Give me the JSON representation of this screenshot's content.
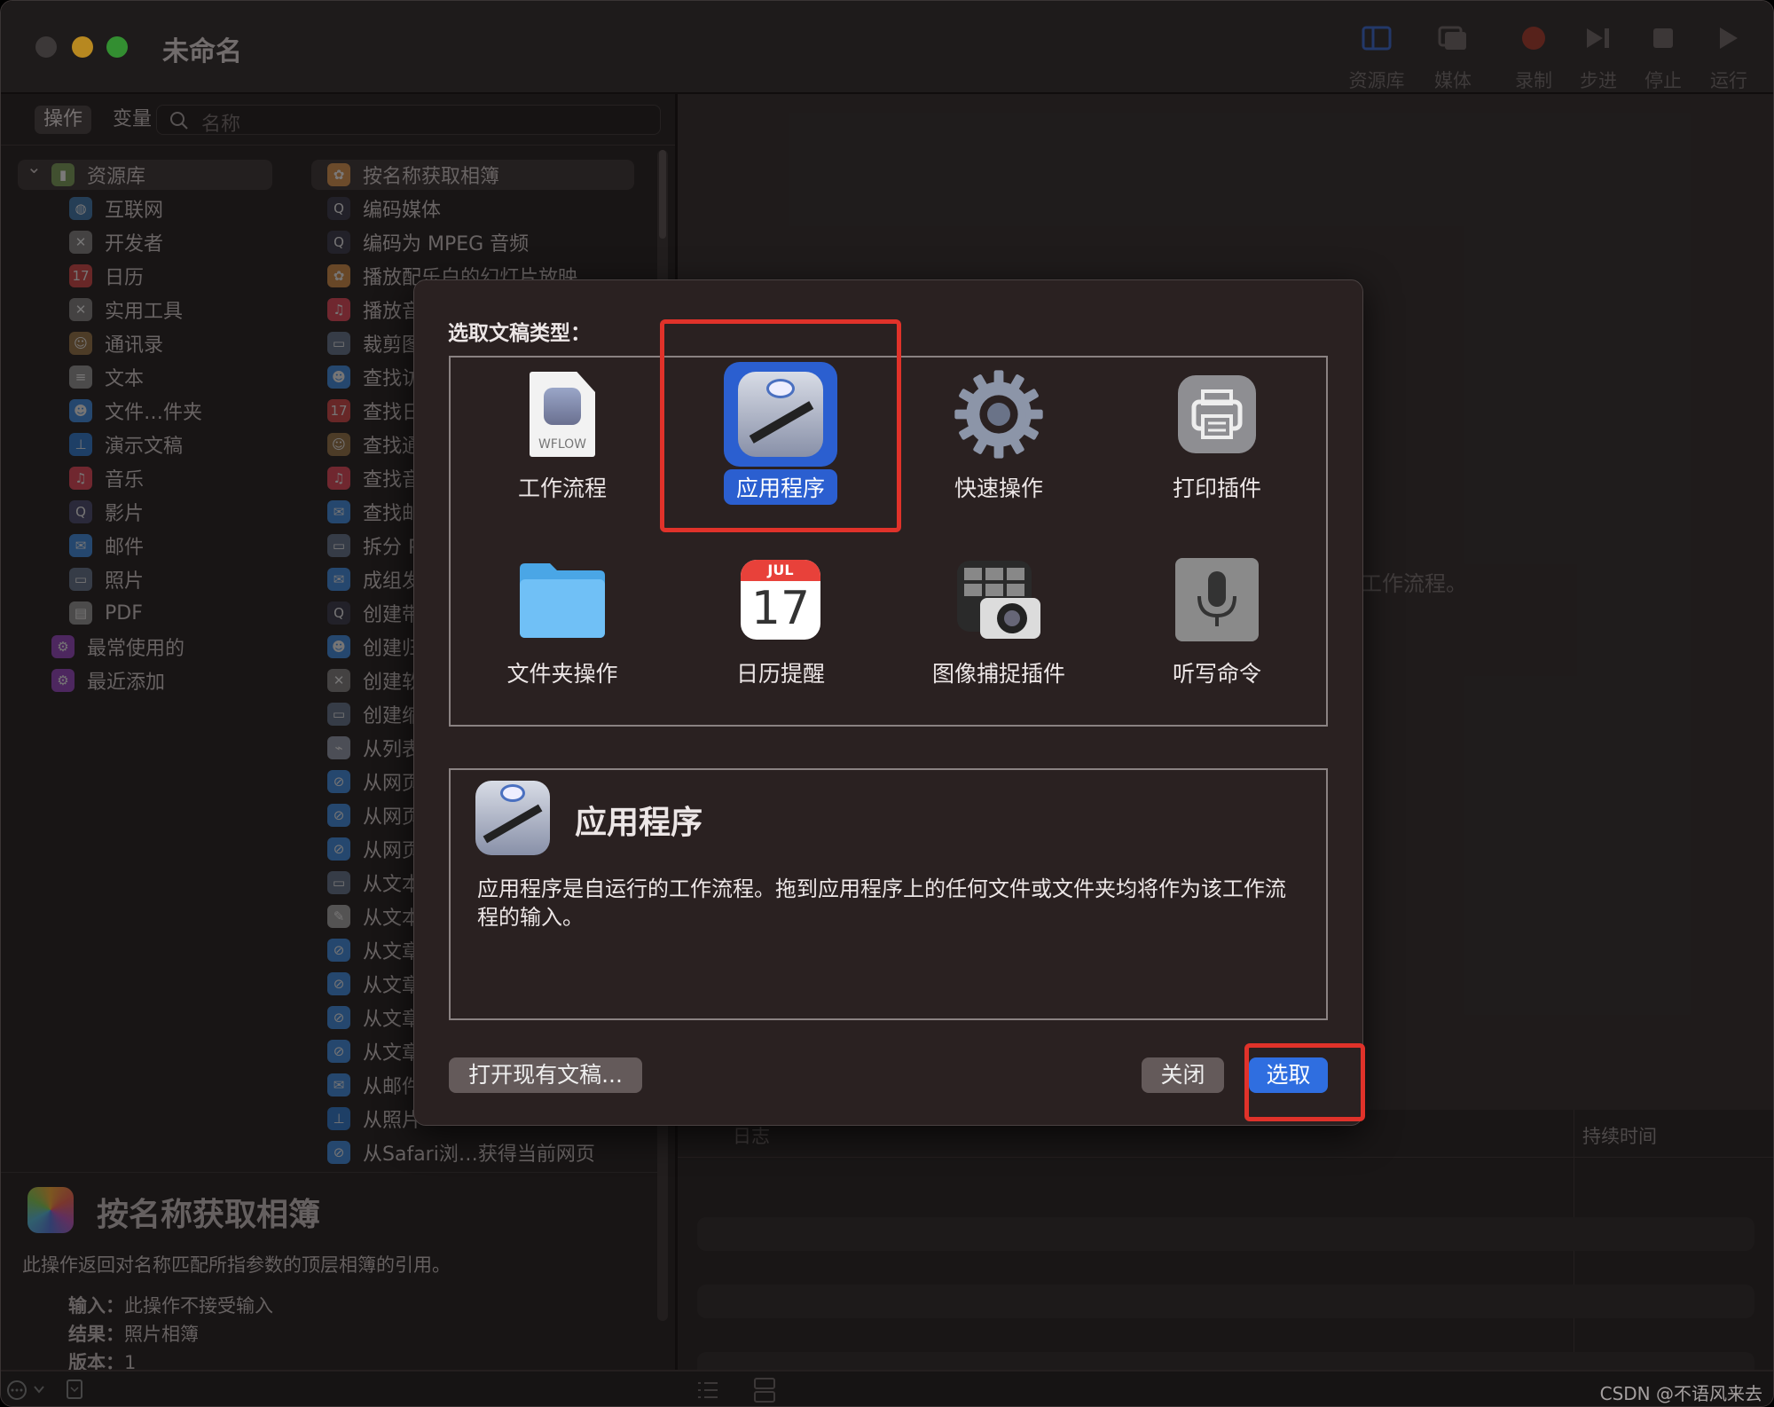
{
  "window": {
    "title": "未命名"
  },
  "toolbar": [
    {
      "label": "资源库",
      "icon": "library-sidebar-icon",
      "color": "#2b4580"
    },
    {
      "label": "媒体",
      "icon": "media-photos-icon",
      "color": "#4a4444"
    },
    {
      "label": "录制",
      "icon": "record-icon",
      "color": "#6b2a22"
    },
    {
      "label": "步进",
      "icon": "step-icon",
      "color": "#4a4444"
    },
    {
      "label": "停止",
      "icon": "stop-icon",
      "color": "#4a4444"
    },
    {
      "label": "运行",
      "icon": "run-icon",
      "color": "#4a4444"
    }
  ],
  "tabs": {
    "actions": "操作",
    "variables": "变量"
  },
  "search": {
    "placeholder": "名称"
  },
  "library": [
    {
      "label": "资源库",
      "icon": "library-icon",
      "color": "#6a8a4a",
      "level": 0,
      "selected": true
    },
    {
      "label": "互联网",
      "icon": "globe-icon",
      "color": "#3a6ea0",
      "level": 1
    },
    {
      "label": "开发者",
      "icon": "tools-icon",
      "color": "#777",
      "level": 1
    },
    {
      "label": "日历",
      "icon": "calendar-icon",
      "color": "#c04040",
      "level": 1
    },
    {
      "label": "实用工具",
      "icon": "tools-icon",
      "color": "#777",
      "level": 1
    },
    {
      "label": "通讯录",
      "icon": "contacts-icon",
      "color": "#8a6a40",
      "level": 1
    },
    {
      "label": "文本",
      "icon": "text-icon",
      "color": "#888",
      "level": 1
    },
    {
      "label": "文件…件夹",
      "icon": "finder-icon",
      "color": "#3a80d0",
      "level": 1
    },
    {
      "label": "演示文稿",
      "icon": "keynote-icon",
      "color": "#2a70c0",
      "level": 1
    },
    {
      "label": "音乐",
      "icon": "music-icon",
      "color": "#d04050",
      "level": 1
    },
    {
      "label": "影片",
      "icon": "quicktime-icon",
      "color": "#446",
      "level": 1
    },
    {
      "label": "邮件",
      "icon": "mail-icon",
      "color": "#3a80d0",
      "level": 1
    },
    {
      "label": "照片",
      "icon": "preview-icon",
      "color": "#5a6a80",
      "level": 1
    },
    {
      "label": "PDF",
      "icon": "pdf-icon",
      "color": "#888",
      "level": 1
    },
    {
      "label": "最常使用的",
      "icon": "smart-folder-icon",
      "color": "#8a40b0",
      "level": 0
    },
    {
      "label": "最近添加",
      "icon": "smart-folder-icon",
      "color": "#8a40b0",
      "level": 0
    }
  ],
  "actions": [
    {
      "label": "按名称获取相簿",
      "icon": "photos-icon",
      "color": "#c08040",
      "selected": true
    },
    {
      "label": "编码媒体",
      "icon": "quicktime-icon",
      "color": "#334"
    },
    {
      "label": "编码为 MPEG 音频",
      "icon": "quicktime-icon",
      "color": "#334"
    },
    {
      "label": "播放配乐白的幻灯片放映",
      "icon": "photos-icon",
      "color": "#c08040"
    },
    {
      "label": "播放音",
      "icon": "music-icon",
      "color": "#d04050"
    },
    {
      "label": "裁剪图",
      "icon": "preview-icon",
      "color": "#5a6a80"
    },
    {
      "label": "查找访",
      "icon": "finder-icon",
      "color": "#3a80d0"
    },
    {
      "label": "查找日",
      "icon": "calendar-icon",
      "color": "#c04040"
    },
    {
      "label": "查找通",
      "icon": "contacts-icon",
      "color": "#8a6a40"
    },
    {
      "label": "查找音",
      "icon": "music-icon",
      "color": "#d04050"
    },
    {
      "label": "查找邮",
      "icon": "mail-icon",
      "color": "#3a80d0"
    },
    {
      "label": "拆分 P",
      "icon": "preview-icon",
      "color": "#5a6a80"
    },
    {
      "label": "成组发",
      "icon": "mail-icon",
      "color": "#3a80d0"
    },
    {
      "label": "创建带",
      "icon": "quicktime-icon",
      "color": "#334"
    },
    {
      "label": "创建归",
      "icon": "finder-icon",
      "color": "#3a80d0"
    },
    {
      "label": "创建软",
      "icon": "tools-icon",
      "color": "#777"
    },
    {
      "label": "创建缩",
      "icon": "preview-icon",
      "color": "#5a6a80"
    },
    {
      "label": "从列表",
      "icon": "automator-icon",
      "color": "#8890a0"
    },
    {
      "label": "从网页",
      "icon": "safari-icon",
      "color": "#3a80d0"
    },
    {
      "label": "从网页",
      "icon": "safari-icon",
      "color": "#3a80d0"
    },
    {
      "label": "从网页",
      "icon": "safari-icon",
      "color": "#3a80d0"
    },
    {
      "label": "从文本",
      "icon": "preview-icon",
      "color": "#5a6a80"
    },
    {
      "label": "从文本",
      "icon": "textedit-icon",
      "color": "#999"
    },
    {
      "label": "从文章",
      "icon": "safari-icon",
      "color": "#3a80d0"
    },
    {
      "label": "从文章",
      "icon": "safari-icon",
      "color": "#3a80d0"
    },
    {
      "label": "从文章",
      "icon": "safari-icon",
      "color": "#3a80d0"
    },
    {
      "label": "从文章",
      "icon": "safari-icon",
      "color": "#3a80d0"
    },
    {
      "label": "从邮件",
      "icon": "mail-icon",
      "color": "#3a80d0"
    },
    {
      "label": "从照片",
      "icon": "keynote-icon",
      "color": "#2a70c0"
    },
    {
      "label": "从Safari浏…获得当前网页",
      "icon": "safari-icon",
      "color": "#3a80d0"
    }
  ],
  "description": {
    "title": "按名称获取相簿",
    "text": "此操作返回对名称匹配所指参数的顶层相簿的引用。",
    "input_label": "输入：",
    "input_value": "此操作不接受输入",
    "result_label": "结果：",
    "result_value": "照片相簿",
    "version_label": "版本：",
    "version_value": "1"
  },
  "workflow_hint": "工作流程。",
  "log": {
    "col_log": "日志",
    "col_duration": "持续时间"
  },
  "watermark": "CSDN @不语风来去",
  "dialog": {
    "label": "选取文稿类型：",
    "types": [
      {
        "label": "工作流程",
        "icon": "workflow-document-icon",
        "badge": "WFLOW"
      },
      {
        "label": "应用程序",
        "icon": "automator-application-icon",
        "selected": true
      },
      {
        "label": "快速操作",
        "icon": "gear-icon"
      },
      {
        "label": "打印插件",
        "icon": "printer-icon"
      },
      {
        "label": "文件夹操作",
        "icon": "folder-icon"
      },
      {
        "label": "日历提醒",
        "icon": "calendar-icon",
        "month": "JUL",
        "day": "17"
      },
      {
        "label": "图像捕捉插件",
        "icon": "image-capture-icon"
      },
      {
        "label": "听写命令",
        "icon": "microphone-icon"
      }
    ],
    "detail_title": "应用程序",
    "detail_text": "应用程序是自运行的工作流程。拖到应用程序上的任何文件或文件夹均将作为该工作流程的输入。",
    "open_existing": "打开现有文稿...",
    "close": "关闭",
    "choose": "选取",
    "highlight_color": "#e0322a",
    "accent": "#2f6ee0"
  }
}
